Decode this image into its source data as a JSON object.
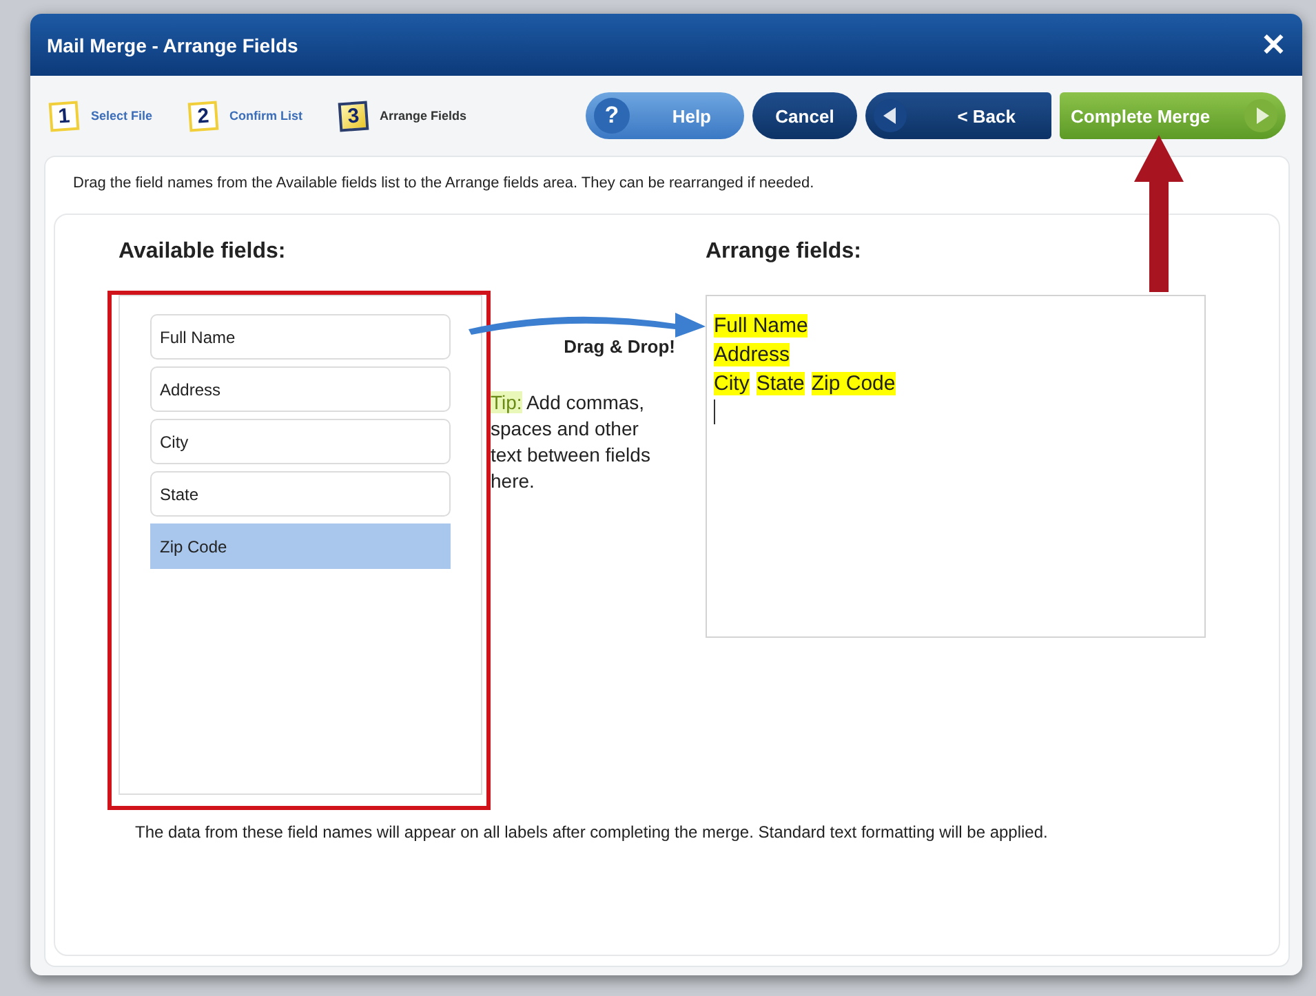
{
  "window": {
    "title": "Mail Merge - Arrange Fields",
    "close": "✕"
  },
  "steps": [
    {
      "number": "1",
      "label": "Select File",
      "current": false
    },
    {
      "number": "2",
      "label": "Confirm List",
      "current": false
    },
    {
      "number": "3",
      "label": "Arrange Fields",
      "current": true
    }
  ],
  "buttons": [
    {
      "kind": "help",
      "label": "Help",
      "icon": "?"
    },
    {
      "kind": "cancel",
      "label": "Cancel"
    },
    {
      "kind": "back",
      "label": "< Back"
    },
    {
      "kind": "next",
      "label": "Complete Merge"
    }
  ],
  "instructions": "Drag the field names from the Available fields list to the Arrange fields area. They can be rearranged if needed.",
  "available_fields": {
    "title": "Available fields:",
    "items": [
      {
        "label": "Full Name",
        "selected": false
      },
      {
        "label": "Address",
        "selected": false
      },
      {
        "label": "City",
        "selected": false
      },
      {
        "label": "State",
        "selected": false
      },
      {
        "label": "Zip Code",
        "selected": true
      }
    ]
  },
  "hint": {
    "title": "Drag & Drop!",
    "tip_label": "Tip:",
    "tip": "Add commas, spaces and other text between fields here."
  },
  "arrange_fields": {
    "title": "Arrange fields:",
    "lines": [
      [
        "Full Name"
      ],
      [
        "Address"
      ],
      [
        "City",
        "State",
        "Zip Code"
      ]
    ]
  },
  "footer": "The data from these field names will appear on all labels after completing the merge. Standard text formatting will be applied."
}
